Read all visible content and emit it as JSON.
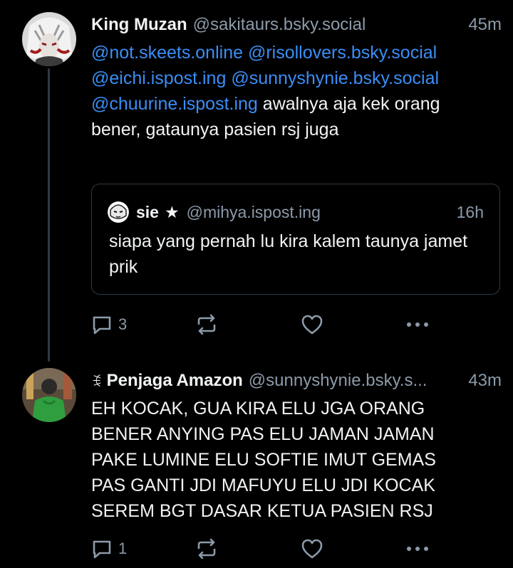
{
  "posts": [
    {
      "author": {
        "display_name": "King Muzan",
        "handle": "@sakitaurs.bsky.social"
      },
      "time": "45m",
      "text_segments": [
        {
          "type": "mention",
          "text": "@not.skeets.online"
        },
        {
          "type": "text",
          "text": " "
        },
        {
          "type": "mention",
          "text": "@risollovers.bsky.social"
        },
        {
          "type": "text",
          "text": " "
        },
        {
          "type": "mention",
          "text": "@eichi.ispost.ing"
        },
        {
          "type": "text",
          "text": " "
        },
        {
          "type": "mention",
          "text": "@sunnyshynie.bsky.social"
        },
        {
          "type": "text",
          "text": " "
        },
        {
          "type": "mention",
          "text": "@chuurine.ispost.ing"
        },
        {
          "type": "text",
          "text": " awalnya aja kek orang bener, gataunya pasien rsj juga"
        }
      ],
      "quote": {
        "author": {
          "display_name": "sie",
          "star": "★",
          "handle": "@mihya.ispost.ing"
        },
        "time": "16h",
        "text": "siapa yang pernah lu kira kalem taunya jamet prik"
      },
      "actions": {
        "reply_count": "3",
        "repost_count": "",
        "like_count": ""
      }
    },
    {
      "author": {
        "badge": "ꉂ",
        "display_name": "Penjaga Amazon",
        "handle": "@sunnyshynie.bsky.s..."
      },
      "time": "43m",
      "text": "EH KOCAK, GUA KIRA ELU JGA ORANG BENER ANYING PAS ELU JAMAN JAMAN PAKE LUMINE ELU SOFTIE IMUT GEMAS PAS GANTI JDI MAFUYU ELU JDI KOCAK SEREM BGT DASAR KETUA PASIEN RSJ",
      "actions": {
        "reply_count": "1",
        "repost_count": "",
        "like_count": ""
      }
    }
  ],
  "colors": {
    "background": "#000000",
    "mention": "#3a8ef6",
    "muted": "#8c9aa9",
    "border": "#2e3a46"
  },
  "icons": [
    "reply-icon",
    "repost-icon",
    "like-icon",
    "more-icon"
  ]
}
